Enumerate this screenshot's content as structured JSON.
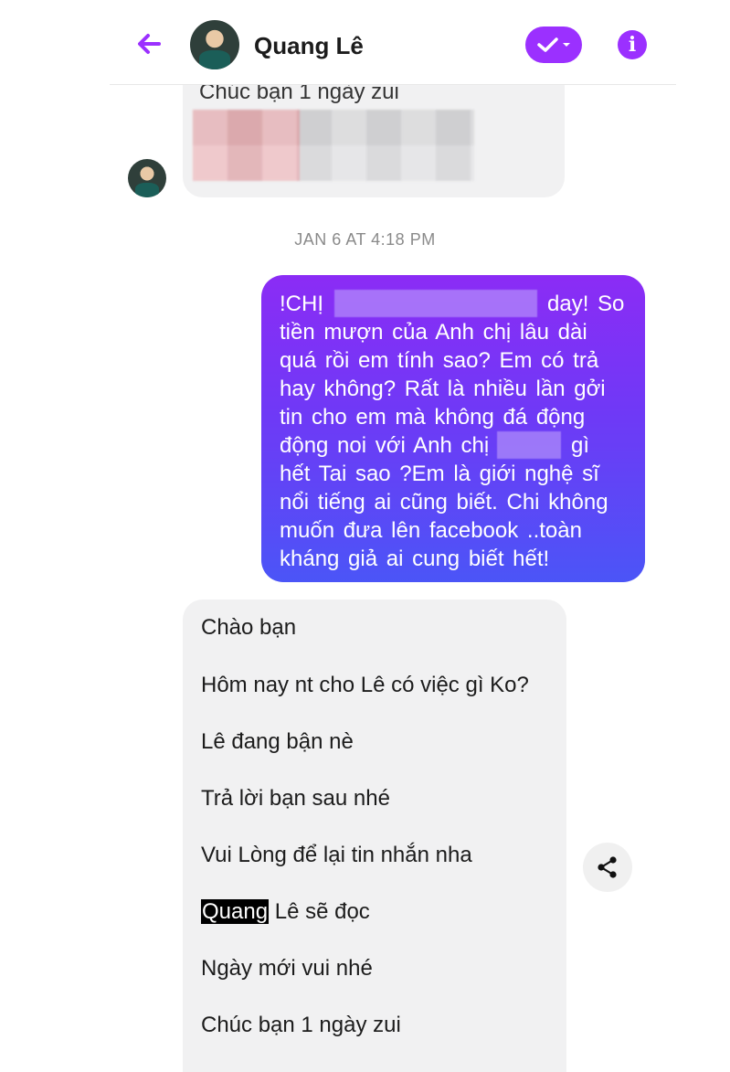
{
  "header": {
    "contact_name": "Quang Lê",
    "back_icon": "arrow-left-icon",
    "check_icon": "check-dropdown-icon",
    "info_icon": "info-icon",
    "info_glyph": "i",
    "accent": "#9b30ff"
  },
  "previous_message": {
    "text": "Chúc bạn 1 ngày zui"
  },
  "timestamp": "JAN 6 AT 4:18 PM",
  "sent_message": {
    "lines": [
      "!CHỊ",
      "tiền  mượn  của  Anh chị lâu dài",
      "quá  rồi  em tính sao? Em có trả",
      "hay không? Rất  là nhiều  lần  gởi",
      "tin cho  em  mà không  đá  động",
      "động  noi với  Anh chị",
      "hết  Tai sao  ?Em là  giới nghệ sĩ",
      "nổi tiếng  ai cũng  biết. Chi không",
      "muốn  đưa  lên  facebook  ..toàn",
      "kháng giả  ai cung biết  hết!"
    ],
    "line1_tail": "day! So",
    "line6_tail": "gì"
  },
  "auto_reply": {
    "lines": [
      "Chào bạn",
      "Hôm nay nt cho Lê có việc gì Ko?",
      "Lê đang bận nè",
      "Trả lời bạn sau nhé",
      "Vui Lòng để lại tin nhắn nha",
      "",
      "Ngày mới vui nhé",
      "Chúc bạn 1 ngày zui"
    ],
    "line6_highlight": "Quang",
    "line6_rest": " Lê sẽ đọc"
  },
  "share_icon": "share-icon"
}
